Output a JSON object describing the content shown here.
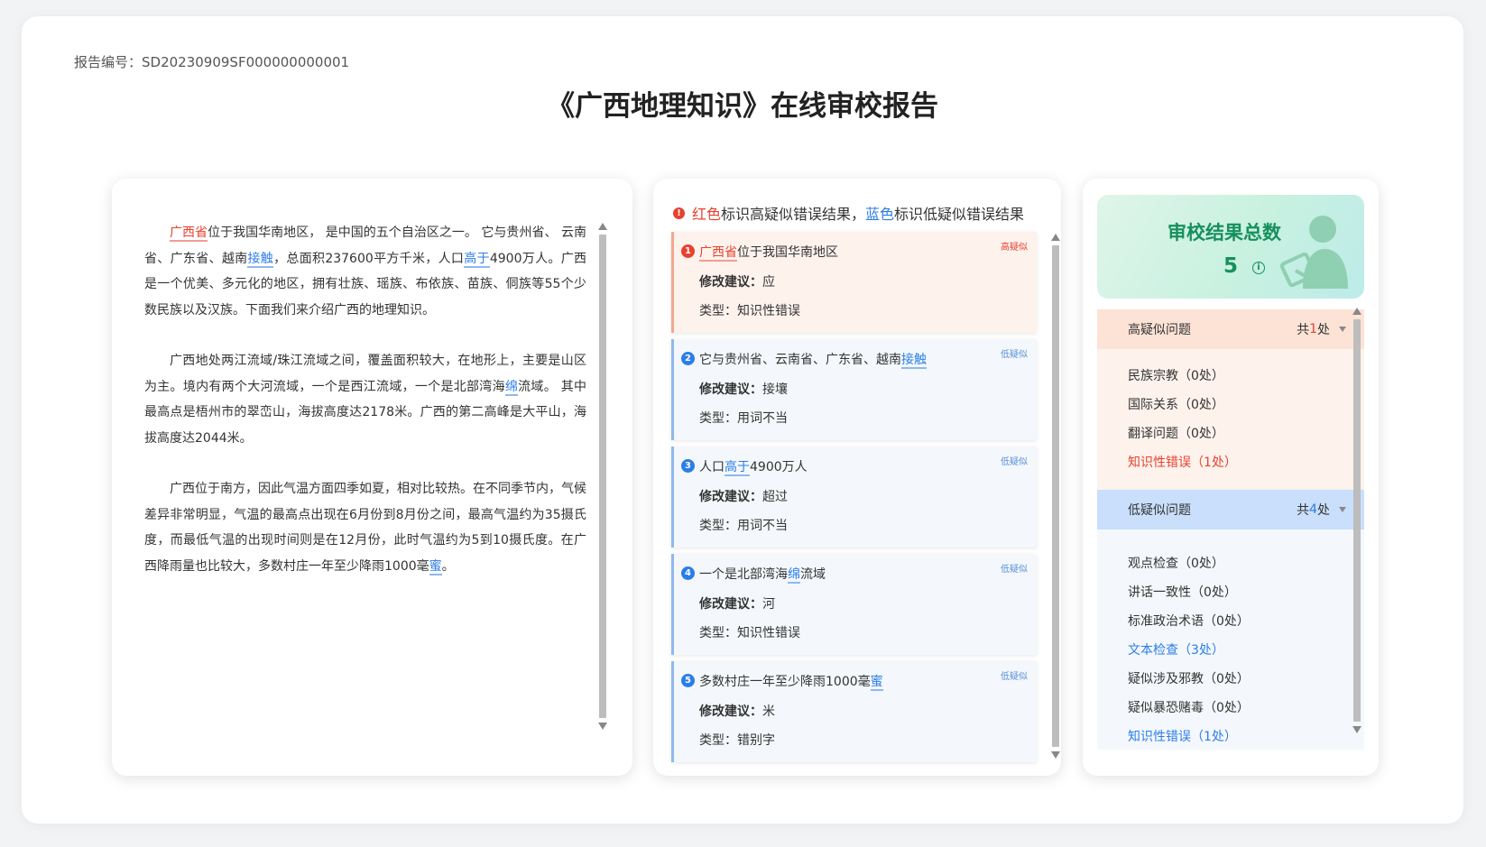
{
  "report": {
    "number_label": "报告编号：SD20230909SF000000000001",
    "title": "《广西地理知识》在线审校报告"
  },
  "document": {
    "paragraphs": [
      [
        {
          "text": "广西省",
          "mark": "red"
        },
        {
          "text": "位于我国华南地区， 是中国的五个自治区之一。 它与贵州省、 云南省、广东省、越南"
        },
        {
          "text": "接触",
          "mark": "blue"
        },
        {
          "text": "，总面积237600平方千米，人口"
        },
        {
          "text": "高于",
          "mark": "blue"
        },
        {
          "text": "4900万人。广西是一个优美、多元化的地区，拥有壮族、瑶族、布依族、苗族、侗族等55个少数民族以及汉族。下面我们来介绍广西的地理知识。"
        }
      ],
      [
        {
          "text": "广西地处两江流域/珠江流域之间，覆盖面积较大，在地形上，主要是山区为主。境内有两个大河流域，一个是西江流域，一个是北部湾海"
        },
        {
          "text": "绵",
          "mark": "blue"
        },
        {
          "text": "流域。 其中最高点是梧州市的翠峦山，海拔高度达2178米。广西的第二高峰是大平山，海拔高度达2044米。"
        }
      ],
      [
        {
          "text": "广西位于南方，因此气温方面四季如夏，相对比较热。在不同季节内，气候差异非常明显，气温的最高点出现在6月份到8月份之间，最高气温约为35摄氏度，而最低气温的出现时间则是在12月份，此时气温约为5到10摄氏度。在广西降雨量也比较大，多数村庄一年至少降雨1000毫"
        },
        {
          "text": "蜜",
          "mark": "blue"
        },
        {
          "text": "。"
        }
      ]
    ]
  },
  "legend": {
    "red_word": "红色",
    "red_text": "标识高疑似错误结果，",
    "blue_word": "蓝色",
    "blue_text": "标识低疑似错误结果"
  },
  "results": [
    {
      "num": "1",
      "level": "高疑似",
      "severity": "high",
      "excerpt": [
        {
          "text": "广西省",
          "mark": "red"
        },
        {
          "text": "位于我国华南地区"
        }
      ],
      "suggest_label": "修改建议：",
      "suggest_value": "应",
      "type_text": "类型：知识性错误"
    },
    {
      "num": "2",
      "level": "低疑似",
      "severity": "low",
      "excerpt": [
        {
          "text": "它与贵州省、云南省、广东省、越南"
        },
        {
          "text": "接触",
          "mark": "blue"
        }
      ],
      "suggest_label": "修改建议：",
      "suggest_value": "接壤",
      "type_text": "类型：用词不当"
    },
    {
      "num": "3",
      "level": "低疑似",
      "severity": "low",
      "excerpt": [
        {
          "text": "人口"
        },
        {
          "text": "高于",
          "mark": "blue"
        },
        {
          "text": "4900万人"
        }
      ],
      "suggest_label": "修改建议：",
      "suggest_value": "超过",
      "type_text": "类型：用词不当"
    },
    {
      "num": "4",
      "level": "低疑似",
      "severity": "low",
      "excerpt": [
        {
          "text": "一个是北部湾海"
        },
        {
          "text": "绵",
          "mark": "blue"
        },
        {
          "text": "流域"
        }
      ],
      "suggest_label": "修改建议：",
      "suggest_value": "河",
      "type_text": "类型：知识性错误"
    },
    {
      "num": "5",
      "level": "低疑似",
      "severity": "low",
      "excerpt": [
        {
          "text": "多数村庄一年至少降雨1000毫"
        },
        {
          "text": "蜜",
          "mark": "blue"
        }
      ],
      "suggest_label": "修改建议：",
      "suggest_value": "米",
      "type_text": "类型：错别字"
    }
  ],
  "summary": {
    "title": "审校结果总数",
    "count": "5",
    "info_icon": "info-icon"
  },
  "categories": {
    "high": {
      "label": "高疑似问题",
      "total_prefix": "共",
      "total_n": "1",
      "total_suffix": "处",
      "items": [
        {
          "label": "民族宗教（0处）",
          "active": false
        },
        {
          "label": "国际关系（0处）",
          "active": false
        },
        {
          "label": "翻译问题（0处）",
          "active": false
        },
        {
          "label": "知识性错误（1处）",
          "active": true
        }
      ]
    },
    "low": {
      "label": "低疑似问题",
      "total_prefix": "共",
      "total_n": "4",
      "total_suffix": "处",
      "items": [
        {
          "label": "观点检查（0处）",
          "active": false
        },
        {
          "label": "讲话一致性（0处）",
          "active": false
        },
        {
          "label": "标准政治术语（0处）",
          "active": false
        },
        {
          "label": "文本检查（3处）",
          "active": true
        },
        {
          "label": "疑似涉及邪教（0处）",
          "active": false
        },
        {
          "label": "疑似暴恐赌毒（0处）",
          "active": false
        },
        {
          "label": "知识性错误（1处）",
          "active": true
        }
      ]
    }
  },
  "colors": {
    "high_accent": "#e8412e",
    "low_accent": "#2b7de9",
    "summary_green": "#17905c"
  }
}
